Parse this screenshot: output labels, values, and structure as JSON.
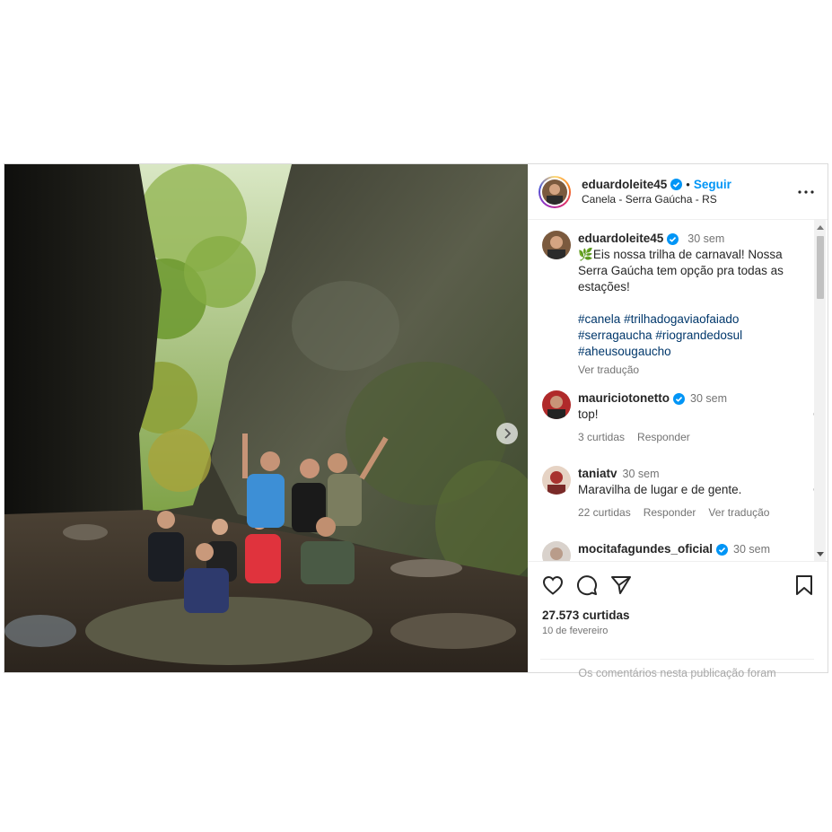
{
  "post": {
    "author": {
      "username": "eduardoleite45",
      "verified": true,
      "follow_label": "Seguir",
      "separator": "•",
      "location": "Canela - Serra Gaúcha - RS"
    },
    "caption": {
      "username": "eduardoleite45",
      "time": "30 sem",
      "leaf_emoji": "🌿",
      "text": "Eis nossa trilha de carnaval! Nossa Serra Gaúcha tem opção pra todas as estações!",
      "hashtags": [
        "#canela",
        "#trilhadogaviaofaiado",
        "#serragaucha",
        "#riograndedosul",
        "#aheusougaucho"
      ],
      "translate_label": "Ver tradução"
    },
    "comments": [
      {
        "username": "mauriciotonetto",
        "verified": true,
        "time": "30 sem",
        "text": "top!",
        "likes": "3 curtidas",
        "reply": "Responder",
        "translate": ""
      },
      {
        "username": "taniatv",
        "verified": false,
        "time": "30 sem",
        "text": "Maravilha de lugar e de gente.",
        "likes": "22 curtidas",
        "reply": "Responder",
        "translate": "Ver tradução"
      },
      {
        "username": "mocitafagundes_oficial",
        "verified": true,
        "time": "30 sem"
      }
    ],
    "likes_count": "27.573 curtidas",
    "date": "10 de fevereiro",
    "comments_disabled": "Os comentários nesta publicação foram"
  },
  "colors": {
    "link_blue": "#0095f6",
    "hashtag_blue": "#00376b",
    "muted_gray": "#737373",
    "border_gray": "#dbdbdb"
  },
  "icons": {
    "header_more": "more-dots-icon",
    "like": "heart-icon",
    "comment": "comment-bubble-icon",
    "share": "send-icon",
    "save": "bookmark-icon",
    "carousel_next": "chevron-right-icon"
  }
}
